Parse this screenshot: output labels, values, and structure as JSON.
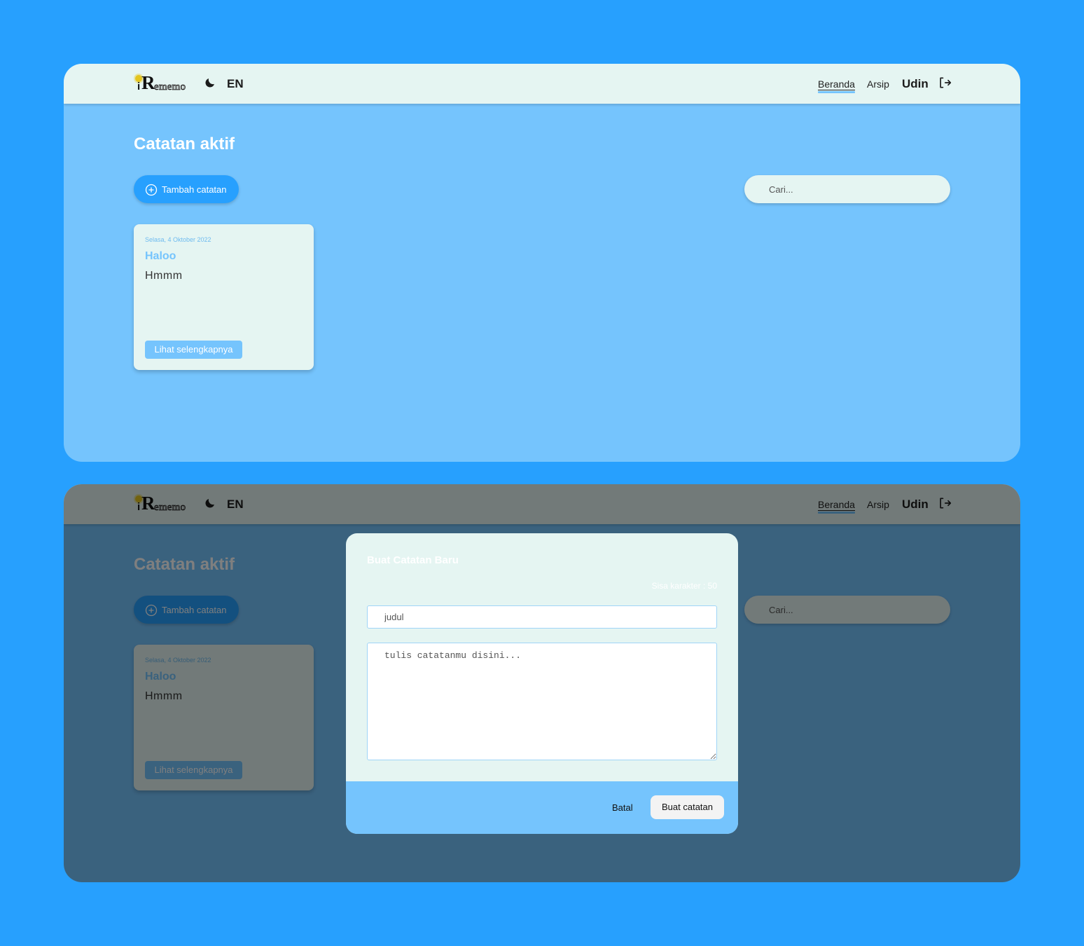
{
  "app": {
    "logo": {
      "mark": "R",
      "prefix": "i",
      "suffix": "ememo"
    },
    "theme_icon": "moon-icon",
    "language": "EN",
    "nav": {
      "home": "Beranda",
      "archive": "Arsip"
    },
    "user": "Udin",
    "logout_icon": "logout-icon"
  },
  "main": {
    "title": "Catatan aktif",
    "add_button": "Tambah catatan",
    "search_placeholder": "Cari..."
  },
  "notes": [
    {
      "date": "Selasa, 4 Oktober 2022",
      "title": "Haloo",
      "body": "Hmmm",
      "more_label": "Lihat selengkapnya"
    }
  ],
  "modal": {
    "title": "Buat Catatan Baru",
    "char_count": "Sisa karakter : 50",
    "title_placeholder": "judul",
    "body_placeholder": "tulis catatanmu disini...",
    "cancel": "Batal",
    "submit": "Buat catatan"
  },
  "colors": {
    "page_background": "#27a0fe",
    "content_background": "#75c4fd",
    "header_background": "#e5f5f2",
    "accent": "#27a0fe"
  }
}
